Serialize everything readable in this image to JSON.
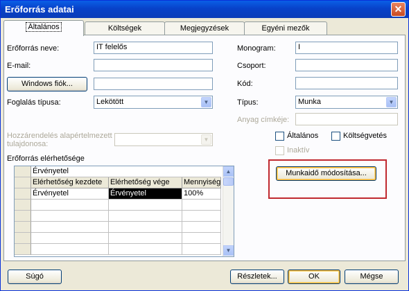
{
  "window": {
    "title": "Erőforrás adatai"
  },
  "tabs": [
    {
      "label": "Általános"
    },
    {
      "label": "Költségek"
    },
    {
      "label": "Megjegyzések"
    },
    {
      "label": "Egyéni mezők"
    }
  ],
  "form": {
    "name_label": "Erőforrás neve:",
    "name_value": "IT felelős",
    "email_label": "E-mail:",
    "email_value": "",
    "windows_account_button": "Windows fiók...",
    "windows_account_value": "",
    "booking_type_label": "Foglalás típusa:",
    "booking_type_value": "Lekötött",
    "assignment_owner_label_line1": "Hozzárendelés alapértelmezett",
    "assignment_owner_label_line2": "tulajdonosa:",
    "assignment_owner_value": "",
    "availability_label": "Erőforrás elérhetősége",
    "initials_label": "Monogram:",
    "initials_value": "I",
    "group_label": "Csoport:",
    "group_value": "",
    "code_label": "Kód:",
    "code_value": "",
    "type_label": "Típus:",
    "type_value": "Munka",
    "material_label": "Anyag címkéje:",
    "material_value": "",
    "generic_label": "Általános",
    "budget_label": "Költségvetés",
    "inactive_label": "Inaktív",
    "change_working_time_button": "Munkaidő módosítása..."
  },
  "availability_grid": {
    "edit_value": "Érvényetel",
    "columns": [
      "Elérhetőség kezdete",
      "Elérhetőség vége",
      "Mennyiség"
    ],
    "rows": [
      [
        "Érvényetel",
        "Érvényetel",
        "100%"
      ]
    ]
  },
  "footer": {
    "help_button": "Súgó",
    "details_button": "Részletek...",
    "ok_button": "OK",
    "cancel_button": "Mégse"
  }
}
